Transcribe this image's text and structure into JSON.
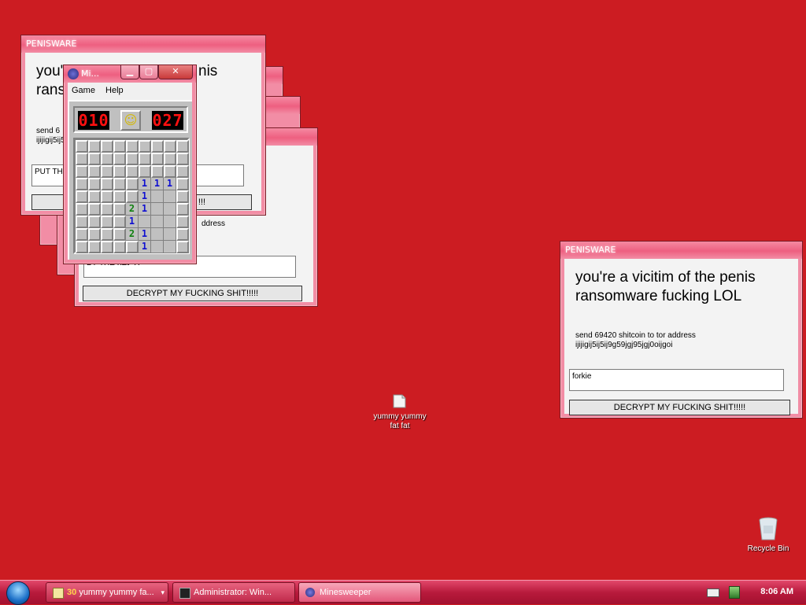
{
  "colors": {
    "desktop": "#cc1c22",
    "title_glass": "#ee5f80",
    "taskbar": "#b81a3c"
  },
  "ransom_windows": [
    {
      "title": "PENISWARE",
      "heading_line1": "you're a vicitim of the penis",
      "heading_line2": "ransomware fucking LOL",
      "send_line1": "send 69420 shitcoin to tor address",
      "send_line2": "ijijigij5ij5ij9g59jgj95jgj0oijgoi",
      "input_value": "forkie",
      "button_label": "DECRYPT MY FUCKING SHIT!!!!!"
    }
  ],
  "back_window": {
    "title": "PENISWARE",
    "heading_line1_left": "you'",
    "heading_line1_right": "nis",
    "heading_line2_left": "rans",
    "send_line1_left": "send 6",
    "send_line2_left": "ijijigij5ij5",
    "input_value_left": "PUT TH",
    "button_label_tail": "!!!"
  },
  "mid_window": {
    "send_fragment": "ddress",
    "input_fragment": "ВY ТНЕ КЕУ Н",
    "button_label": "DECRYPT MY FUCKING SHIT!!!!!"
  },
  "minesweeper": {
    "title": "Mi...",
    "menu": [
      "Game",
      "Help"
    ],
    "mines_left": "010",
    "timer": "027",
    "smiley": "☺",
    "grid": [
      [
        "",
        "",
        "",
        "",
        "",
        "",
        "",
        "",
        ""
      ],
      [
        "",
        "",
        "",
        "",
        "",
        "",
        "",
        "",
        ""
      ],
      [
        "",
        "",
        "",
        "",
        "",
        "",
        "",
        "",
        ""
      ],
      [
        "",
        "",
        "",
        "",
        "",
        "1",
        "1",
        "1",
        ""
      ],
      [
        "",
        "",
        "",
        "",
        "",
        "1",
        "o",
        "o",
        ""
      ],
      [
        "",
        "",
        "",
        "",
        "2",
        "1",
        "o",
        "o",
        ""
      ],
      [
        "",
        "",
        "",
        "",
        "1",
        "o",
        "o",
        "o",
        ""
      ],
      [
        "",
        "",
        "",
        "",
        "2",
        "1",
        "o",
        "o",
        ""
      ],
      [
        "",
        "",
        "",
        "",
        "",
        "1",
        "o",
        "o",
        ""
      ]
    ]
  },
  "desktop_icons": [
    {
      "label_line1": "yummy yummy",
      "label_line2": "fat fat",
      "icon": "folder-icon"
    },
    {
      "label_line1": "Recycle Bin",
      "icon": "recycle-bin-icon"
    }
  ],
  "taskbar": {
    "buttons": [
      {
        "count": "30",
        "label": "yummy yummy fa...",
        "icon": "folder-icon"
      },
      {
        "label": "Administrator: Win...",
        "icon": "cmd-icon"
      },
      {
        "label": "Minesweeper",
        "icon": "mine-icon"
      }
    ],
    "clock": "8:06 AM"
  }
}
